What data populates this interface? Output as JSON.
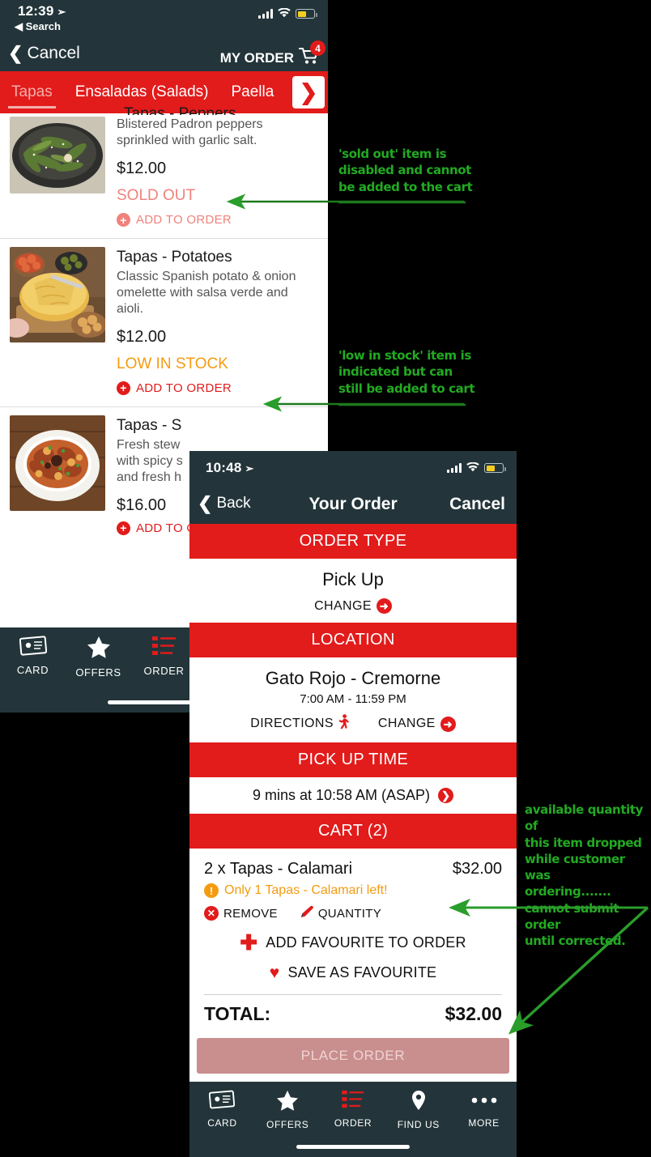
{
  "phone1": {
    "status_bar": {
      "time": "12:39",
      "back_app": "◀ Search",
      "location_icon": "location-arrow-icon"
    },
    "nav": {
      "back_label": "Cancel",
      "order_label": "MY ORDER",
      "cart_badge": "4"
    },
    "tabs": [
      {
        "label": "Tapas",
        "active": true
      },
      {
        "label": "Ensaladas (Salads)",
        "active": false
      },
      {
        "label": "Paella",
        "active": false
      }
    ],
    "tab_next_icon": "chevron-right-icon",
    "menu_items": [
      {
        "title": "Tapas - Peppers",
        "desc": "Blistered Padron peppers sprinkled with garlic salt.",
        "price": "$12.00",
        "stock": "SOLD OUT",
        "stock_state": "sold-out",
        "add_label": "ADD TO ORDER"
      },
      {
        "title": "Tapas - Potatoes",
        "desc": "Classic Spanish potato & onion omelette with salsa verde and aioli.",
        "price": "$12.00",
        "stock": "LOW IN STOCK",
        "stock_state": "low-stock",
        "add_label": "ADD TO ORDER"
      },
      {
        "title": "Tapas - S",
        "desc": "Fresh stew\nwith spicy s\nand fresh h",
        "price": "$16.00",
        "stock": "",
        "stock_state": "none",
        "add_label": "ADD TO O"
      }
    ],
    "tabbar": [
      {
        "label": "CARD",
        "icon": "card-icon"
      },
      {
        "label": "OFFERS",
        "icon": "star-icon"
      },
      {
        "label": "ORDER",
        "icon": "list-icon"
      }
    ]
  },
  "phone2": {
    "status_bar": {
      "time": "10:48",
      "location_icon": "location-arrow-icon"
    },
    "nav": {
      "back_label": "Back",
      "title": "Your Order",
      "cancel_label": "Cancel"
    },
    "order_type": {
      "heading": "ORDER TYPE",
      "value": "Pick Up",
      "change_label": "CHANGE"
    },
    "location": {
      "heading": "LOCATION",
      "name": "Gato Rojo - Cremorne",
      "hours": "7:00 AM - 11:59 PM",
      "directions_label": "DIRECTIONS",
      "change_label": "CHANGE"
    },
    "pickup_time": {
      "heading": "PICK UP TIME",
      "value": "9 mins at 10:58 AM (ASAP)"
    },
    "cart": {
      "heading": "CART (2)",
      "item_name": "2 x Tapas - Calamari",
      "item_price": "$32.00",
      "warning": "Only 1 Tapas - Calamari left!",
      "remove_label": "REMOVE",
      "quantity_label": "QUANTITY",
      "add_favourite_label": "ADD FAVOURITE TO ORDER",
      "save_favourite_label": "SAVE AS FAVOURITE",
      "total_label": "TOTAL:",
      "total_value": "$32.00"
    },
    "place_order_label": "PLACE ORDER",
    "tabbar": [
      {
        "label": "CARD",
        "icon": "card-icon"
      },
      {
        "label": "OFFERS",
        "icon": "star-icon"
      },
      {
        "label": "ORDER",
        "icon": "list-icon"
      },
      {
        "label": "FIND US",
        "icon": "map-pin-icon"
      },
      {
        "label": "MORE",
        "icon": "ellipsis-icon"
      }
    ]
  },
  "annotations": {
    "sold_out": "'sold out' item is\ndisabled and cannot\nbe added to the cart",
    "low_stock": "'low in stock' item is\nindicated but can\nstill be added to cart",
    "cart_qty": "available quantity of\nthis item dropped\nwhile customer was\nordering.......\ncannot submit order\nuntil corrected."
  },
  "colors": {
    "brand_red": "#e21b1b",
    "dark_navy": "#23353a",
    "low_stock_orange": "#f49b10",
    "sold_out_faded": "#f0827c",
    "annotation_green": "#22aa22",
    "disabled_button": "#c98e8e"
  }
}
